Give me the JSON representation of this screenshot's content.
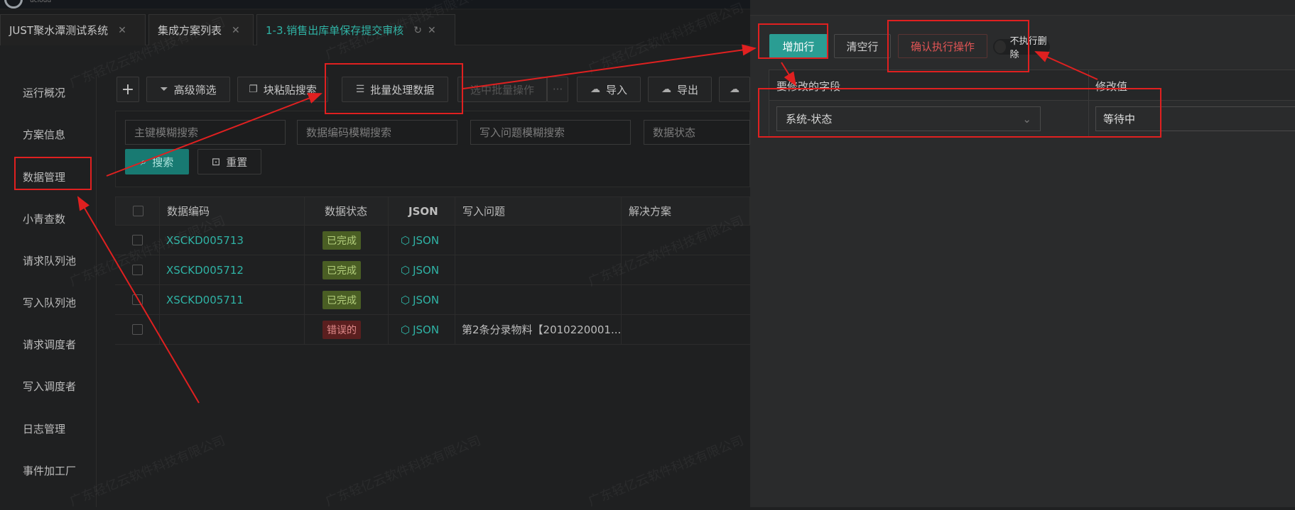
{
  "logo": {
    "text": "ucloud"
  },
  "tabs": [
    {
      "label": "JUST聚水潭测试系统"
    },
    {
      "label": "集成方案列表"
    },
    {
      "label": "1-3.销售出库单保存提交审核"
    }
  ],
  "sidebar": {
    "items": [
      {
        "label": "运行概况"
      },
      {
        "label": "方案信息"
      },
      {
        "label": "数据管理"
      },
      {
        "label": "小青查数"
      },
      {
        "label": "请求队列池"
      },
      {
        "label": "写入队列池"
      },
      {
        "label": "请求调度者"
      },
      {
        "label": "写入调度者"
      },
      {
        "label": "日志管理"
      },
      {
        "label": "事件加工厂"
      }
    ]
  },
  "toolbar": {
    "add": "+",
    "advanced_filter": "高级筛选",
    "block_paste": "块粘贴搜索",
    "batch_process": "批量处理数据",
    "selected_batch": "选中批量操作",
    "more": "···",
    "import": "导入",
    "export": "导出"
  },
  "search": {
    "primary_key_ph": "主键模糊搜索",
    "data_code_ph": "数据编码模糊搜索",
    "write_issue_ph": "写入问题模糊搜索",
    "data_status_ph": "数据状态",
    "search_btn": "搜索",
    "reset_btn": "重置"
  },
  "table": {
    "headers": {
      "code": "数据编码",
      "status": "数据状态",
      "json": "JSON",
      "issue": "写入问题",
      "solution": "解决方案"
    },
    "rows": [
      {
        "code": "XSCKD005713",
        "status": "已完成",
        "json": "JSON",
        "issue": ""
      },
      {
        "code": "XSCKD005712",
        "status": "已完成",
        "json": "JSON",
        "issue": ""
      },
      {
        "code": "XSCKD005711",
        "status": "已完成",
        "json": "JSON",
        "issue": ""
      },
      {
        "code": "",
        "status": "错误的",
        "json": "JSON",
        "issue": "第2条分录物料【2010220001..."
      }
    ]
  },
  "panel": {
    "add_row": "增加行",
    "clear_rows": "清空行",
    "confirm": "确认执行操作",
    "no_delete": "不执行删除",
    "headers": {
      "field": "要修改的字段",
      "value": "修改值"
    },
    "field_value": "系统-状态",
    "new_value": "等待中"
  },
  "watermark": "广东轻亿云软件科技有限公司",
  "colors": {
    "accent": "#2fb3a5",
    "annotation": "#e02020",
    "error": "#e05555"
  }
}
